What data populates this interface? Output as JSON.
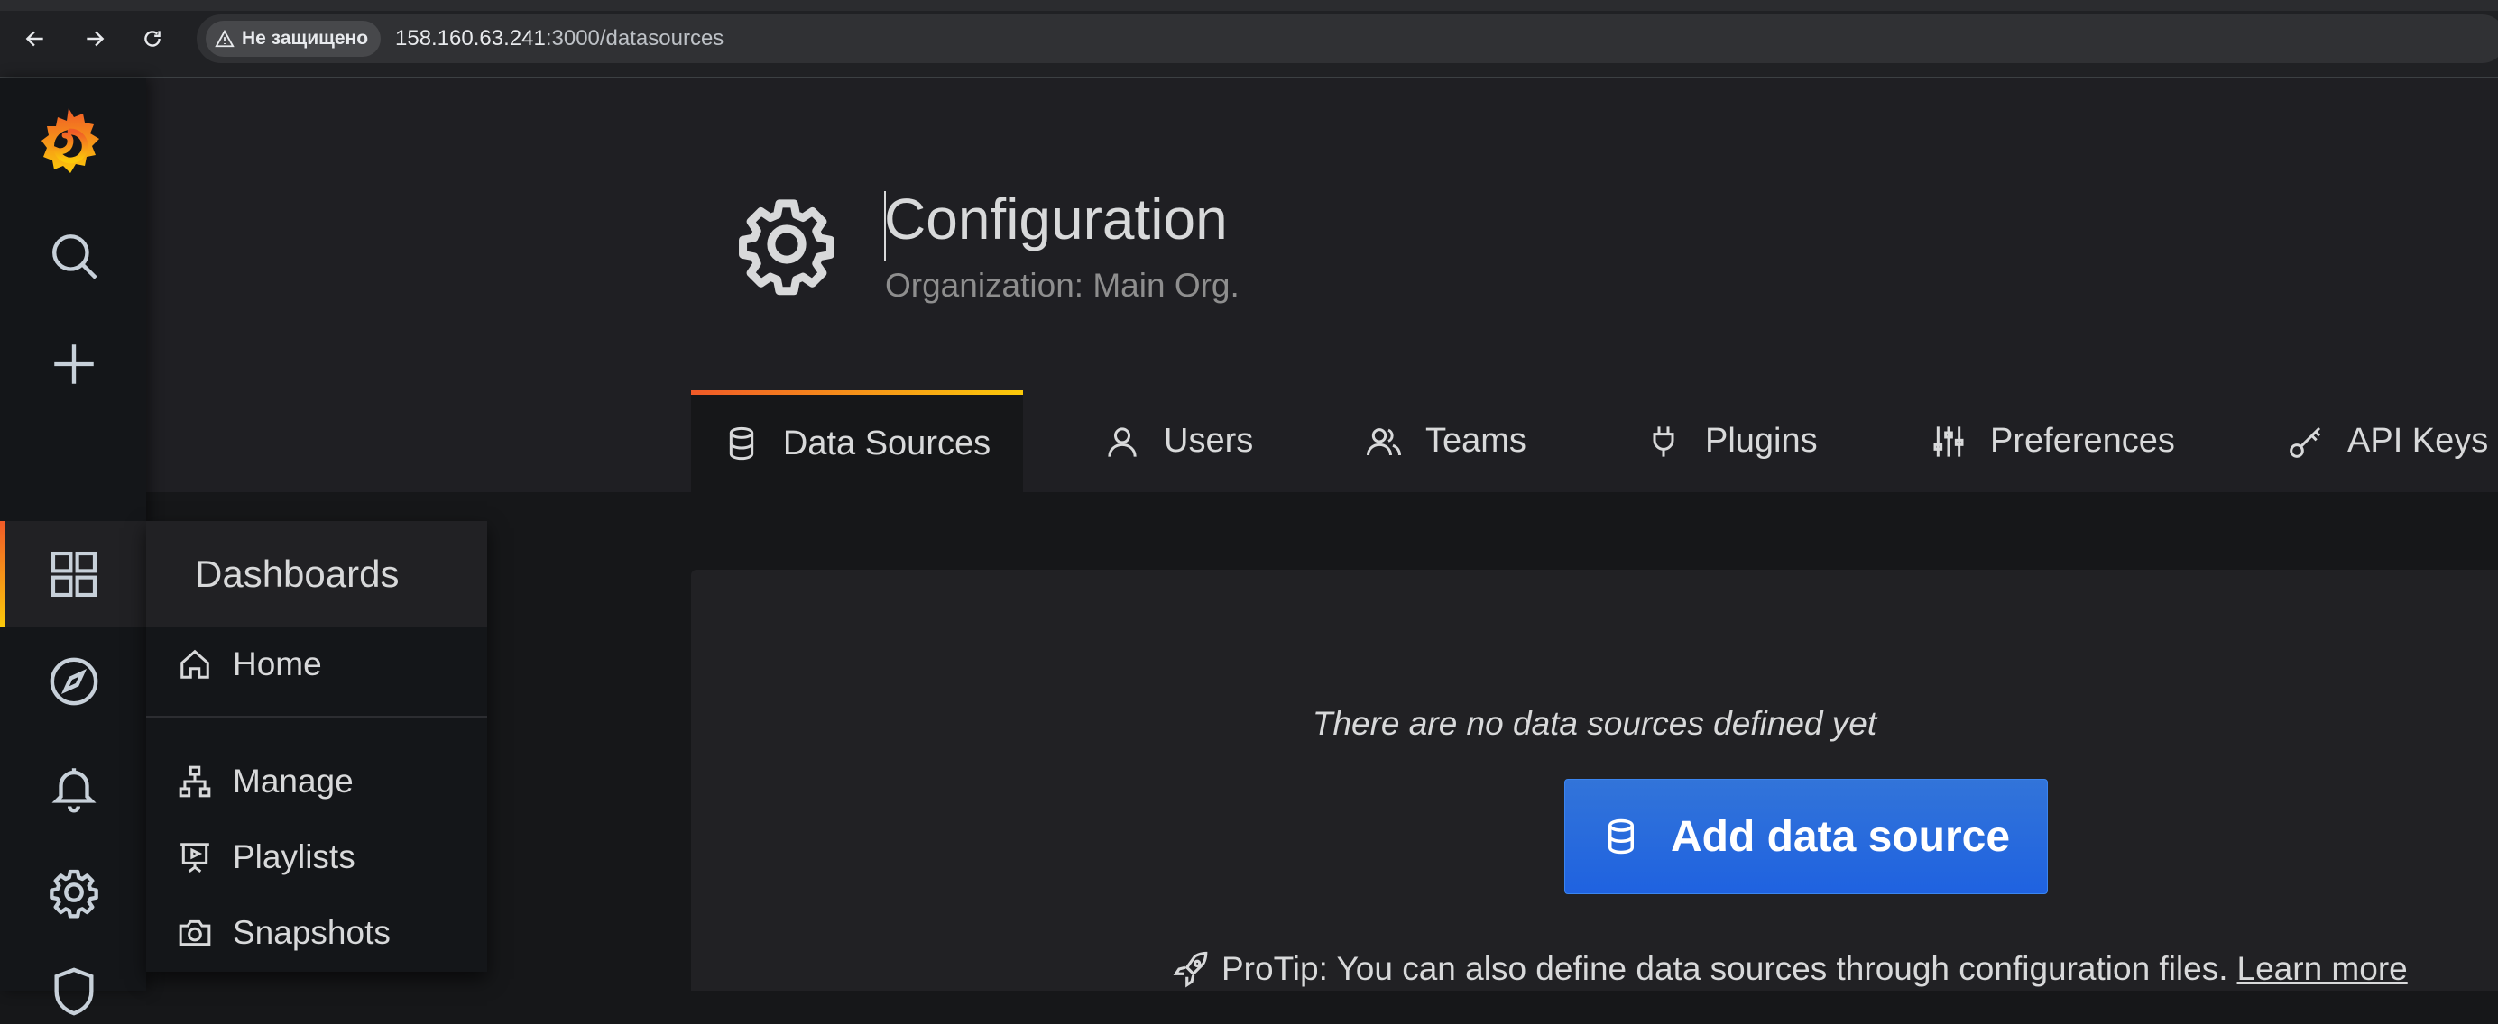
{
  "browser": {
    "security_label": "Не защищено",
    "url_host": "158.160.63.241",
    "url_path": ":3000/datasources"
  },
  "sidemenu": {
    "icons": [
      "grafana-logo-icon",
      "search-icon",
      "plus-icon",
      "dashboards-icon",
      "explore-icon",
      "bell-icon",
      "gear-icon",
      "shield-icon"
    ],
    "active": "dashboards"
  },
  "dashboards_menu": {
    "title": "Dashboards",
    "items": [
      {
        "label": "Home",
        "icon": "home-icon"
      },
      {
        "label": "Manage",
        "icon": "sitemap-icon"
      },
      {
        "label": "Playlists",
        "icon": "presentation-play-icon"
      },
      {
        "label": "Snapshots",
        "icon": "camera-icon"
      }
    ]
  },
  "page": {
    "title": "Configuration",
    "subtitle": "Organization: Main Org."
  },
  "tabs": [
    {
      "label": "Data Sources",
      "icon": "database-icon",
      "active": true
    },
    {
      "label": "Users",
      "icon": "user-icon"
    },
    {
      "label": "Teams",
      "icon": "users-icon"
    },
    {
      "label": "Plugins",
      "icon": "plug-icon"
    },
    {
      "label": "Preferences",
      "icon": "sliders-icon"
    },
    {
      "label": "API Keys",
      "icon": "key-icon"
    }
  ],
  "content": {
    "empty_message": "There are no data sources defined yet",
    "add_button_label": "Add data source",
    "protip_text": "ProTip: You can also define data sources through configuration files.",
    "learn_more_label": "Learn more"
  },
  "colors": {
    "accent_gradient_start": "#f05a28",
    "accent_gradient_end": "#fbca0a",
    "primary_button": "#3274d9",
    "background": "#161719"
  }
}
